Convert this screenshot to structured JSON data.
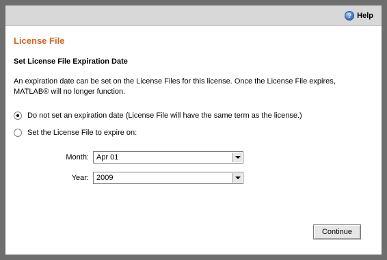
{
  "header": {
    "help_label": "Help",
    "help_icon": "help-icon"
  },
  "section_title": "License File",
  "subheading": "Set License File Expiration Date",
  "description": "An expiration date can be set on the License Files for this license. Once the License File expires, MATLAB® will no longer function.",
  "options": [
    {
      "label": "Do not set an expiration date (License File will have the same term as the license.)",
      "selected": true
    },
    {
      "label": "Set the License File to expire on:",
      "selected": false
    }
  ],
  "fields": {
    "month": {
      "label": "Month:",
      "value": "Apr 01"
    },
    "year": {
      "label": "Year:",
      "value": "2009"
    }
  },
  "actions": {
    "continue_label": "Continue"
  },
  "colors": {
    "accent": "#d8621e",
    "frame": "#6e6e6e",
    "topbar": "#d8d8d8"
  }
}
